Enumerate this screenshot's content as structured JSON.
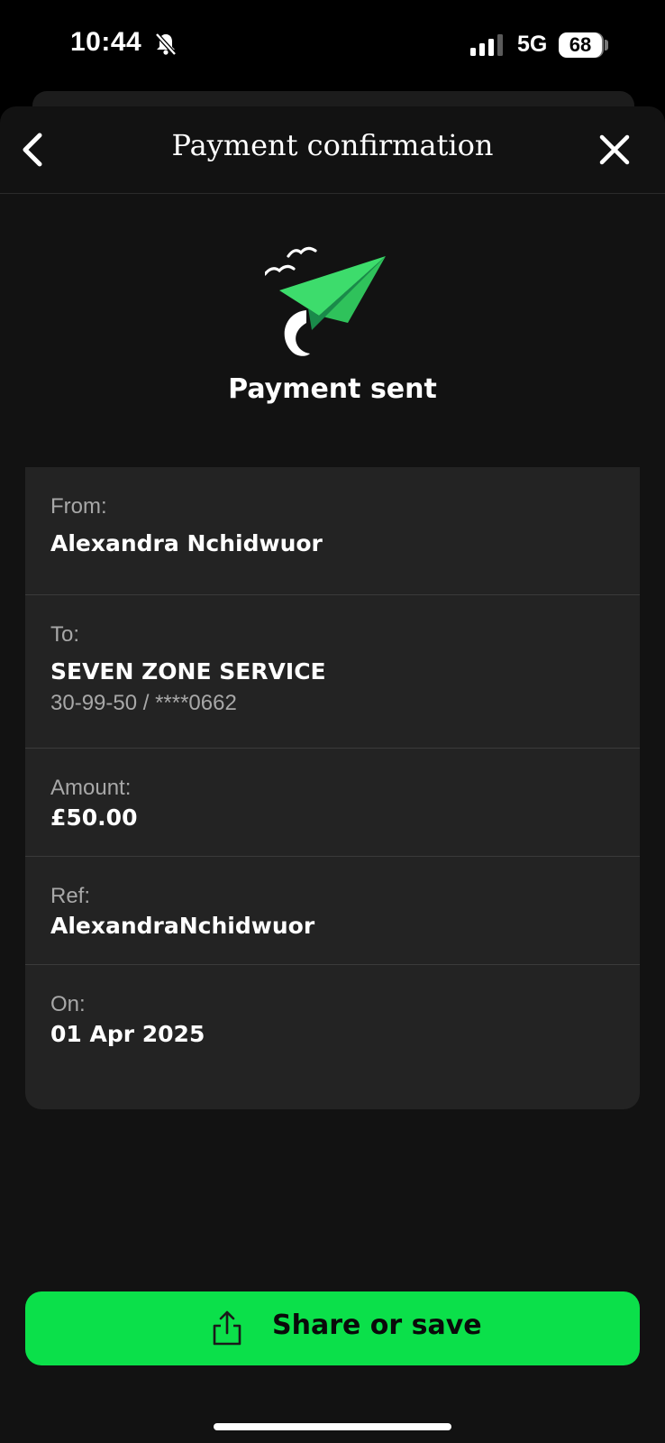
{
  "status_bar": {
    "time": "10:44",
    "network": "5G",
    "battery": "68",
    "icons": [
      "bell-slash-icon",
      "signal-icon"
    ]
  },
  "nav": {
    "title": "Payment confirmation",
    "back_icon": "chevron-left-icon",
    "close_icon": "close-icon"
  },
  "hero": {
    "icon": "paper-plane-icon",
    "title": "Payment sent"
  },
  "details": {
    "from": {
      "label": "From:",
      "value": "Alexandra Nchidwuor"
    },
    "to": {
      "label": "To:",
      "value": "SEVEN ZONE SERVICE",
      "sub": "30-99-50 / ****0662"
    },
    "amount": {
      "label": "Amount:",
      "value": "£50.00"
    },
    "ref": {
      "label": "Ref:",
      "value": "AlexandraNchidwuor"
    },
    "on": {
      "label": "On:",
      "value": "01 Apr 2025"
    }
  },
  "share": {
    "label": "Share or save",
    "icon": "share-icon"
  },
  "colors": {
    "background": "#121212",
    "card": "#232323",
    "accent": "#0be04a",
    "muted_text": "#a8a8a8"
  }
}
